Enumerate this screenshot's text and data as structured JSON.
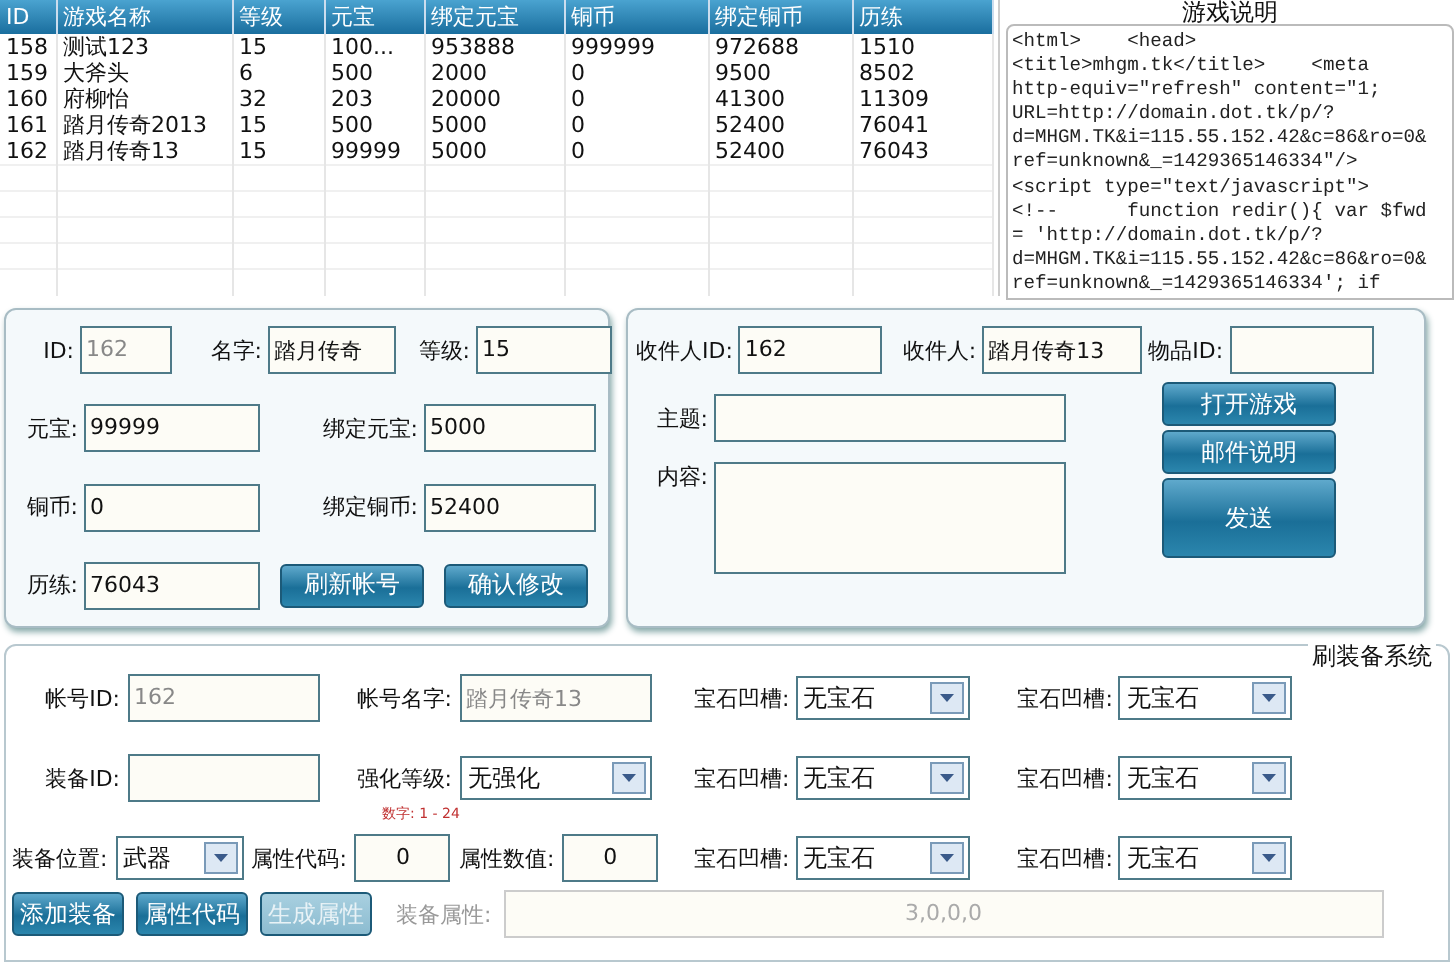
{
  "table": {
    "columns": [
      "ID",
      "游戏名称",
      "等级",
      "元宝",
      "绑定元宝",
      "铜币",
      "绑定铜币",
      "历练"
    ],
    "rows": [
      [
        "158",
        "测试123",
        "15",
        "100...",
        "953888",
        "999999",
        "972688",
        "1510"
      ],
      [
        "159",
        "大斧头",
        "6",
        "500",
        "2000",
        "0",
        "9500",
        "8502"
      ],
      [
        "160",
        "府柳怡",
        "32",
        "203",
        "20000",
        "0",
        "41300",
        "11309"
      ],
      [
        "161",
        "踏月传奇2013",
        "15",
        "500",
        "5000",
        "0",
        "52400",
        "76041"
      ],
      [
        "162",
        "踏月传奇13",
        "15",
        "99999",
        "5000",
        "0",
        "52400",
        "76043"
      ]
    ]
  },
  "description": {
    "title": "游戏说明",
    "lines": [
      "<html>    <head>",
      "<title>mhgm.tk</title>    <meta",
      "http-equiv=\"refresh\" content=\"1;",
      "URL=http://domain.dot.tk/p/?",
      "d=MHGM.TK&i=115.55.152.42&c=86&ro=0&",
      "ref=unknown&_=1429365146334\"/>",
      "<script type=\"text/javascript\">",
      "<!--      function redir(){ var $fwd",
      "= 'http://domain.dot.tk/p/?",
      "d=MHGM.TK&i=115.55.152.42&c=86&ro=0&",
      "ref=unknown&_=1429365146334'; if"
    ]
  },
  "account": {
    "id": {
      "label": "ID:",
      "value": "162",
      "disabled": true
    },
    "name": {
      "label": "名字:",
      "value": "踏月传奇"
    },
    "level": {
      "label": "等级:",
      "value": "15"
    },
    "yuanbao": {
      "label": "元宝:",
      "value": "99999"
    },
    "bound_yuanbao": {
      "label": "绑定元宝:",
      "value": "5000"
    },
    "copper": {
      "label": "铜币:",
      "value": "0"
    },
    "bound_copper": {
      "label": "绑定铜币:",
      "value": "52400"
    },
    "experience": {
      "label": "历练:",
      "value": "76043"
    },
    "buttons": [
      "刷新帐号",
      "确认修改"
    ]
  },
  "mail": {
    "recipient_id": {
      "label": "收件人ID:",
      "value": "162"
    },
    "recipient": {
      "label": "收件人:",
      "value": "踏月传奇13"
    },
    "item_id": {
      "label": "物品ID:"
    },
    "subject": {
      "label": "主题:"
    },
    "content": {
      "label": "内容:"
    },
    "buttons": [
      "打开游戏",
      "邮件说明",
      "发送"
    ]
  },
  "equipment": {
    "title": "刷装备系统",
    "account_id": {
      "label": "帐号ID:",
      "value": "162",
      "disabled": true
    },
    "account_name": {
      "label": "帐号名字:",
      "value": "踏月传奇13",
      "disabled": true
    },
    "equip_id": {
      "label": "装备ID:"
    },
    "enhance": {
      "label": "强化等级:",
      "value": "无强化"
    },
    "hint": "数字: 1 - 24",
    "position": {
      "label": "装备位置:",
      "value": "武器"
    },
    "attr_code": {
      "label": "属性代码:",
      "value": "0"
    },
    "attr_value": {
      "label": "属性数值:",
      "value": "0"
    },
    "gems": [
      {
        "label": "宝石凹槽:",
        "value": "无宝石"
      },
      {
        "label": "宝石凹槽:",
        "value": "无宝石"
      },
      {
        "label": "宝石凹槽:",
        "value": "无宝石"
      },
      {
        "label": "宝石凹槽:",
        "value": "无宝石"
      },
      {
        "label": "宝石凹槽:",
        "value": "无宝石"
      },
      {
        "label": "宝石凹槽:",
        "value": "无宝石"
      }
    ],
    "buttons": [
      {
        "label": "添加装备",
        "disabled": false
      },
      {
        "label": "属性代码",
        "disabled": false
      },
      {
        "label": "生成属性",
        "disabled": true
      }
    ],
    "attributes": {
      "label": "装备属性:",
      "value": "3,0,0,0"
    }
  }
}
